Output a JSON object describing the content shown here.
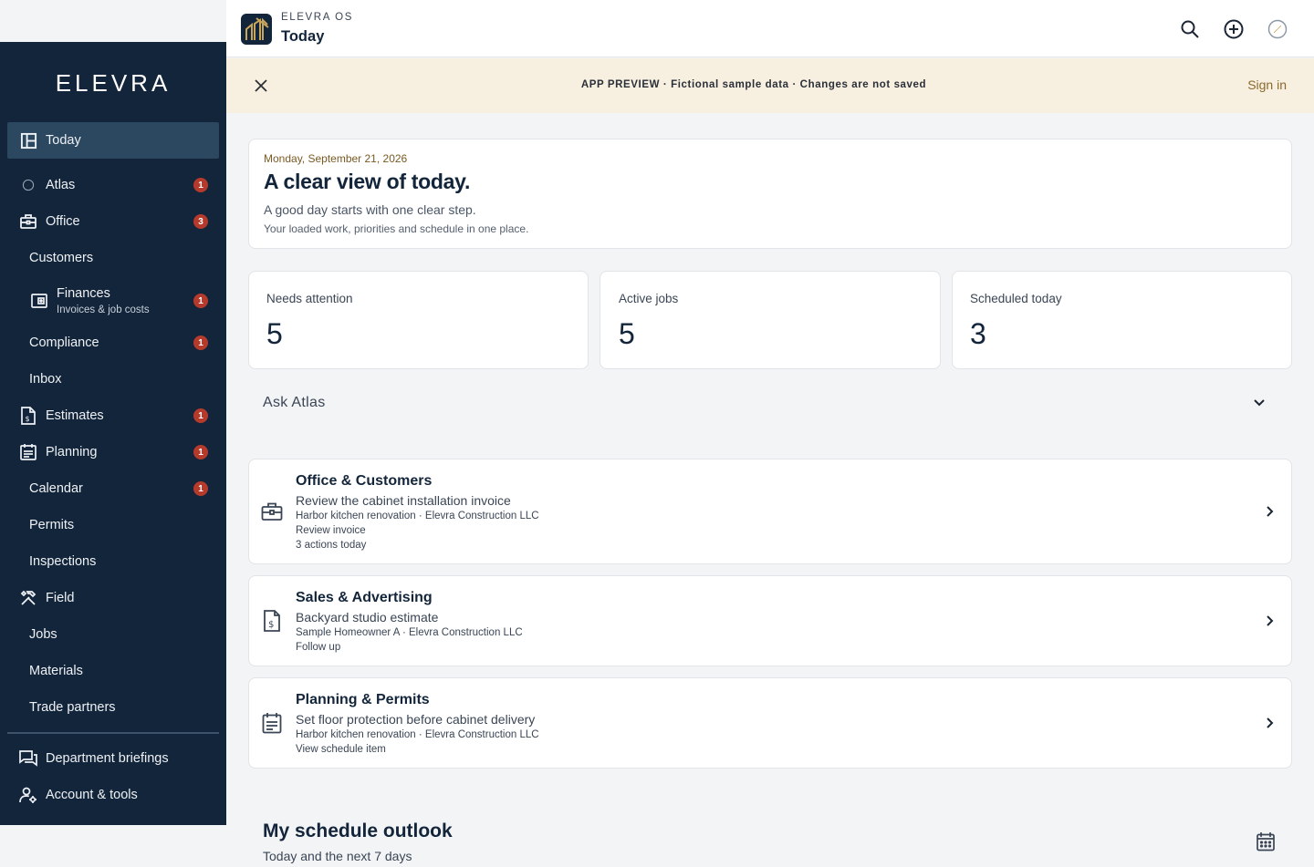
{
  "sidebar": {
    "logo": "ELEVRA",
    "items": [
      {
        "label": "Today",
        "icon": "dashboard-icon",
        "badge": ""
      },
      {
        "label": "Atlas",
        "icon": "compass-icon",
        "badge": "1"
      },
      {
        "label": "Office",
        "icon": "briefcase-icon",
        "badge": "3"
      },
      {
        "label": "Customers",
        "badge": ""
      },
      {
        "label": "Finances",
        "sublabel": "Invoices & job costs",
        "icon": "wallet-icon",
        "badge": "1"
      },
      {
        "label": "Compliance",
        "badge": "1"
      },
      {
        "label": "Inbox",
        "badge": ""
      },
      {
        "label": "Estimates",
        "icon": "invoice-icon",
        "badge": "1"
      },
      {
        "label": "Planning",
        "icon": "calendar-list-icon",
        "badge": "1"
      },
      {
        "label": "Calendar",
        "badge": "1"
      },
      {
        "label": "Permits",
        "badge": ""
      },
      {
        "label": "Inspections",
        "badge": ""
      },
      {
        "label": "Field",
        "icon": "tools-icon",
        "badge": ""
      },
      {
        "label": "Jobs",
        "badge": ""
      },
      {
        "label": "Materials",
        "badge": ""
      },
      {
        "label": "Trade partners",
        "badge": ""
      }
    ],
    "bottom_items": [
      {
        "label": "Department briefings",
        "icon": "chat-icon"
      },
      {
        "label": "Account & tools",
        "icon": "user-gear-icon"
      }
    ]
  },
  "header": {
    "app_name": "ELEVRA OS",
    "page_title": "Today",
    "buttons": [
      "search-icon",
      "add-circle-icon",
      "compass-icon"
    ]
  },
  "banner": {
    "text": "APP PREVIEW · Fictional sample data · Changes are not saved",
    "signin": "Sign in"
  },
  "today": {
    "date": "Monday, September 21, 2026",
    "title": "A clear view of today.",
    "subtitle": "A good day starts with one clear step.",
    "description": "Your loaded work, priorities and schedule in one place."
  },
  "stats": [
    {
      "label": "Needs attention",
      "value": "5"
    },
    {
      "label": "Active jobs",
      "value": "5"
    },
    {
      "label": "Scheduled today",
      "value": "3"
    }
  ],
  "ask_atlas": {
    "label": "Ask Atlas"
  },
  "tasks": [
    {
      "title": "Office & Customers",
      "description": "Review the cabinet installation invoice",
      "meta": [
        "Harbor kitchen renovation · Elevra Construction LLC",
        "Review invoice",
        "3 actions today"
      ],
      "icon": "briefcase-icon"
    },
    {
      "title": "Sales & Advertising",
      "description": "Backyard studio estimate",
      "meta": [
        "Sample Homeowner A · Elevra Construction LLC",
        "Follow up"
      ],
      "icon": "invoice-icon"
    },
    {
      "title": "Planning & Permits",
      "description": "Set floor protection before cabinet delivery",
      "meta": [
        "Harbor kitchen renovation · Elevra Construction LLC",
        "View schedule item"
      ],
      "icon": "calendar-list-icon"
    }
  ],
  "outlook": {
    "title": "My schedule outlook",
    "subtitle": "Today and the next 7 days"
  },
  "colors": {
    "sidebar_bg": "#13253a",
    "sidebar_active": "#2c4760",
    "badge": "#b53a2c",
    "banner_bg": "#f7efdf",
    "accent_gold": "#8c6a2e"
  }
}
